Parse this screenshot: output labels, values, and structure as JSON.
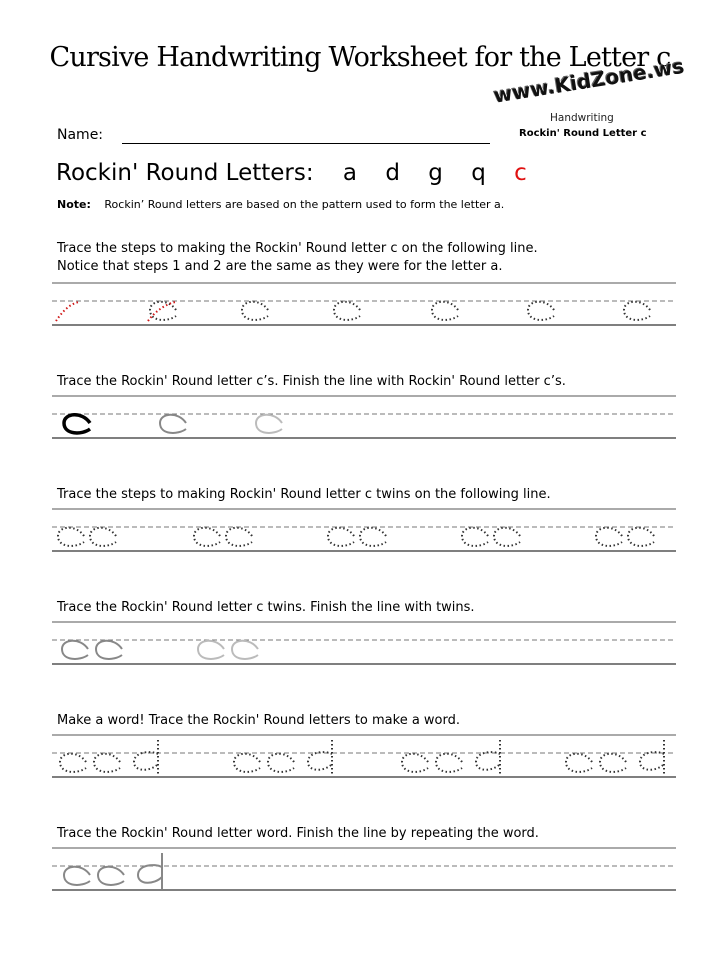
{
  "title": "Cursive Handwriting Worksheet for the Letter c",
  "logo": {
    "site": "www.KidZone.ws",
    "sub": "Handwriting",
    "sub2": "Rockin' Round Letter c"
  },
  "name_label": "Name:",
  "heading": {
    "text": "Rockin' Round Letters:",
    "letters": [
      "a",
      "d",
      "g",
      "q",
      "c"
    ],
    "highlight_color": "#e01010"
  },
  "note": {
    "label": "Note:",
    "text": "Rockin’ Round letters are based on the pattern used to form the letter a."
  },
  "sections": [
    {
      "instruction": [
        "Trace the steps to making the Rockin' Round letter c on the following line.",
        "Notice that steps 1 and 2 are the same as they were for the letter a."
      ],
      "practice": "c c c c c c c"
    },
    {
      "instruction": [
        "Trace the Rockin' Round letter c’s.  Finish the line with Rockin' Round letter c’s."
      ],
      "practice": "c c c"
    },
    {
      "instruction": [
        "Trace the steps to making Rockin' Round letter c twins on the following line."
      ],
      "practice": "cc cc cc cc cc"
    },
    {
      "instruction": [
        "Trace the Rockin' Round letter c twins.  Finish the line with twins."
      ],
      "practice": "cc cc"
    },
    {
      "instruction": [
        "Make a word!  Trace the Rockin' Round letters to make a word."
      ],
      "practice": "cad cad cad cad"
    },
    {
      "instruction": [
        "Trace the Rockin' Round letter word.  Finish the line by repeating the word."
      ],
      "practice": "cad"
    }
  ]
}
